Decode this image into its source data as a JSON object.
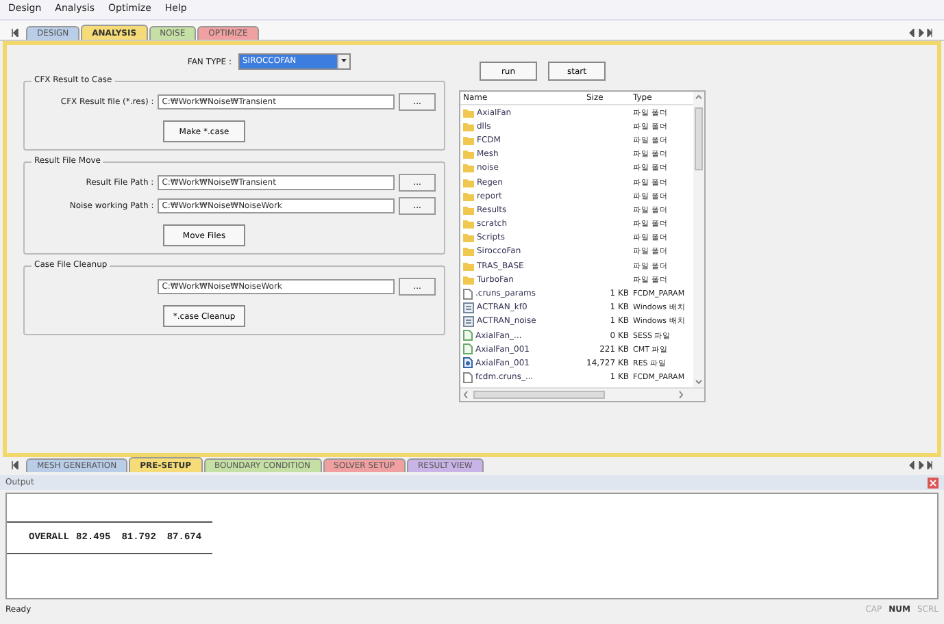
{
  "menu": [
    "Design",
    "Analysis",
    "Optimize",
    "Help"
  ],
  "top_tabs": [
    {
      "label": "DESIGN",
      "color": "#b9cde8",
      "selected": false
    },
    {
      "label": "ANALYSIS",
      "color": "#f5dc78",
      "selected": true
    },
    {
      "label": "NOISE",
      "color": "#c5e0a5",
      "selected": false
    },
    {
      "label": "OPTIMIZE",
      "color": "#f0a0a0",
      "selected": false
    }
  ],
  "fan_type": {
    "label": "FAN TYPE :",
    "value": "SIROCCOFAN"
  },
  "groups": [
    {
      "title": "CFX Result to Case",
      "fields": [
        {
          "label": "CFX Result file (*.res) :",
          "value": "C:₩Work₩Noise₩Transient"
        }
      ],
      "button": "Make *.case"
    },
    {
      "title": "Result File Move",
      "fields": [
        {
          "label": "Result File Path :",
          "value": "C:₩Work₩Noise₩Transient"
        },
        {
          "label": "Noise working Path :",
          "value": "C:₩Work₩Noise₩NoiseWork"
        }
      ],
      "button": "Move Files"
    },
    {
      "title": "Case File Cleanup",
      "fields": [
        {
          "value": "C:₩Work₩Noise₩NoiseWork"
        }
      ],
      "button": "*.case Cleanup"
    }
  ],
  "browse_button": "...",
  "action_buttons": [
    "run",
    "start"
  ],
  "file_list": {
    "columns": [
      "Name",
      "Size",
      "Type"
    ],
    "rows": [
      {
        "kind": "folder",
        "name": "AxialFan",
        "type": "파일 폴더"
      },
      {
        "kind": "folder",
        "name": "dlls",
        "type": "파일 폴더"
      },
      {
        "kind": "folder",
        "name": "FCDM",
        "type": "파일 폴더"
      },
      {
        "kind": "folder",
        "name": "Mesh",
        "type": "파일 폴더"
      },
      {
        "kind": "folder",
        "name": "noise",
        "type": "파일 폴더"
      },
      {
        "kind": "folder",
        "name": "Regen",
        "type": "파일 폴더"
      },
      {
        "kind": "folder",
        "name": "report",
        "type": "파일 폴더"
      },
      {
        "kind": "folder",
        "name": "Results",
        "type": "파일 폴더"
      },
      {
        "kind": "folder",
        "name": "scratch",
        "type": "파일 폴더"
      },
      {
        "kind": "folder",
        "name": "Scripts",
        "type": "파일 폴더"
      },
      {
        "kind": "folder",
        "name": "SiroccoFan",
        "type": "파일 폴더"
      },
      {
        "kind": "folder",
        "name": "TRAS_BASE",
        "type": "파일 폴더"
      },
      {
        "kind": "folder",
        "name": "TurboFan",
        "type": "파일 폴더"
      },
      {
        "kind": "file",
        "name": ".cruns_params",
        "size": "1 KB",
        "type": "FCDM_PARAM"
      },
      {
        "kind": "batch",
        "name": "ACTRAN_kf0",
        "size": "1 KB",
        "type": "Windows 배치"
      },
      {
        "kind": "batch",
        "name": "ACTRAN_noise",
        "size": "1 KB",
        "type": "Windows 배치"
      },
      {
        "kind": "doc",
        "name": "AxialFan_...",
        "size": "0 KB",
        "type": "SESS 파일"
      },
      {
        "kind": "doc",
        "name": "AxialFan_001",
        "size": "221 KB",
        "type": "CMT 파일"
      },
      {
        "kind": "res",
        "name": "AxialFan_001",
        "size": "14,727 KB",
        "type": "RES 파일"
      },
      {
        "kind": "file",
        "name": "fcdm.cruns_...",
        "size": "1 KB",
        "type": "FCDM_PARAM"
      }
    ]
  },
  "bottom_tabs": [
    {
      "label": "MESH GENERATION",
      "color": "#b9cde8",
      "selected": false
    },
    {
      "label": "PRE-SETUP",
      "color": "#f5dc78",
      "selected": true
    },
    {
      "label": "BOUNDARY CONDITION",
      "color": "#c5e0a5",
      "selected": false
    },
    {
      "label": "SOLVER SETUP",
      "color": "#f0a0a0",
      "selected": false
    },
    {
      "label": "RESULT VIEW",
      "color": "#c8b4e6",
      "selected": false
    }
  ],
  "output": {
    "title": "Output",
    "row": [
      "OVERALL",
      "82.495",
      "81.792",
      "87.674"
    ]
  },
  "status_bar": {
    "text": "Ready",
    "indicators": [
      {
        "label": "CAP",
        "on": false
      },
      {
        "label": "NUM",
        "on": true
      },
      {
        "label": "SCRL",
        "on": false
      }
    ]
  }
}
